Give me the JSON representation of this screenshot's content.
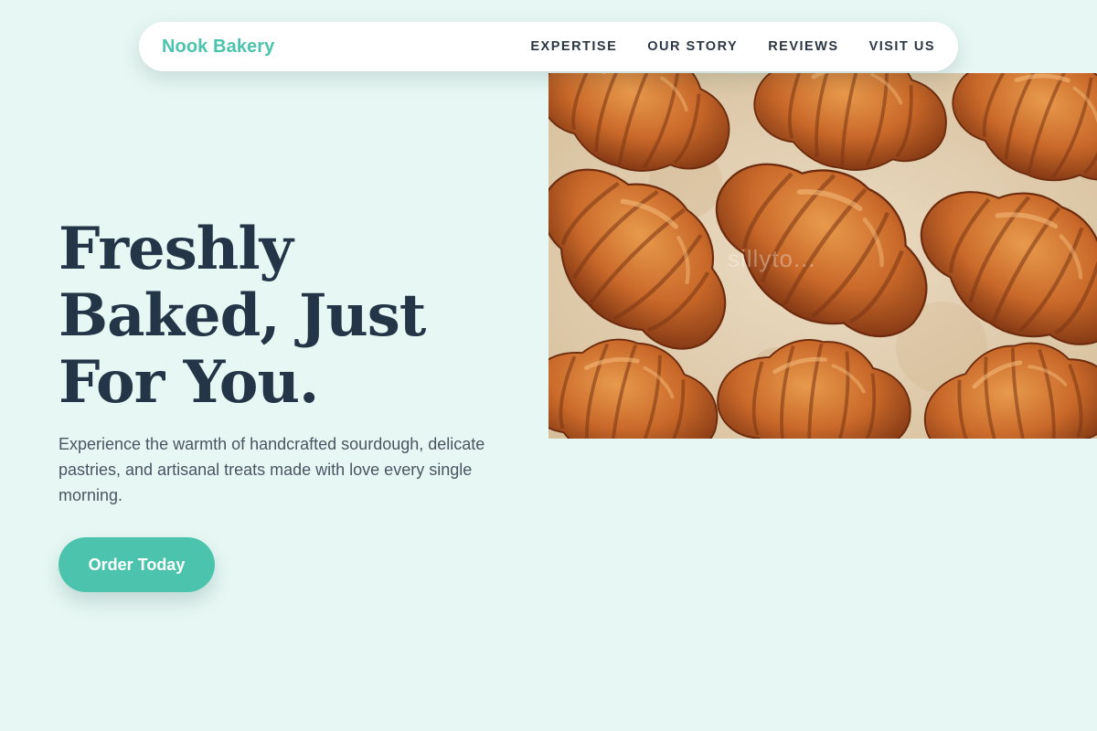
{
  "nav": {
    "brand": "Nook Bakery",
    "links": [
      "EXPERTISE",
      "OUR STORY",
      "REVIEWS",
      "VISIT US"
    ]
  },
  "hero": {
    "title_lines": [
      "Freshly",
      "Baked, Just",
      "For You."
    ],
    "description": "Experience the warmth of handcrafted sourdough, delicate pastries, and artisanal treats made with love every single morning.",
    "cta_label": "Order Today",
    "image_watermark": "sillyto..."
  },
  "colors": {
    "background": "#e7f7f4",
    "accent": "#4cc4ad",
    "heading": "#243547",
    "body_text": "#4a5562",
    "nav_text": "#2b3643"
  }
}
